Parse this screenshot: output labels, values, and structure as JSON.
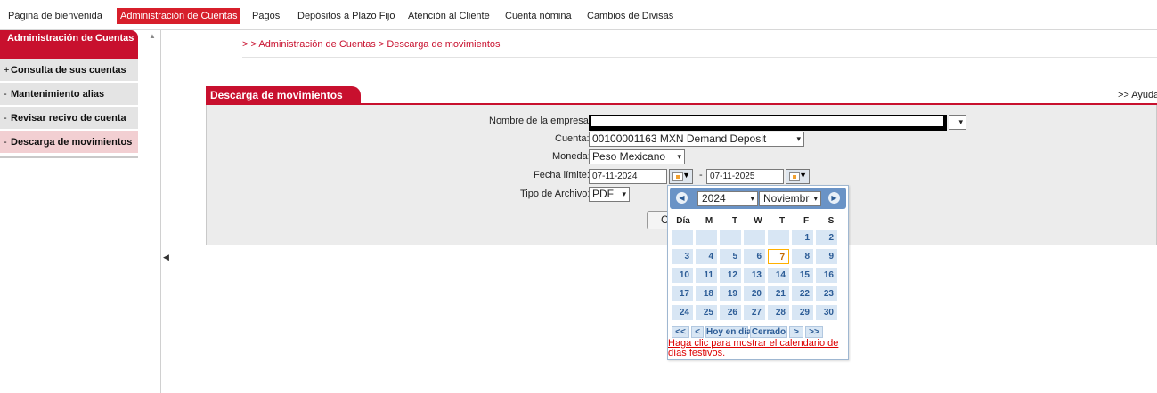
{
  "topnav": [
    {
      "label": "Página de bienvenida",
      "active": false
    },
    {
      "label": "Administración de Cuentas",
      "active": true
    },
    {
      "label": "Pagos",
      "active": false
    },
    {
      "label": "Depósitos a Plazo Fijo",
      "active": false
    },
    {
      "label": "Atención al Cliente",
      "active": false
    },
    {
      "label": "Cuenta nómina",
      "active": false
    },
    {
      "label": "Cambios de Divisas",
      "active": false
    }
  ],
  "sidebar": {
    "header": "Administración de Cuentas",
    "items": [
      {
        "bullet": "+",
        "label": "Consulta de sus cuentas",
        "selected": false
      },
      {
        "bullet": "-",
        "label": "Mantenimiento alias",
        "selected": false
      },
      {
        "bullet": "-",
        "label": "Revisar recivo de cuenta",
        "selected": false
      },
      {
        "bullet": "-",
        "label": "Descarga de movimientos",
        "selected": true
      }
    ]
  },
  "breadcrumb": "> > Administración de Cuentas > Descarga de movimientos",
  "panel": {
    "title": "Descarga de movimientos",
    "help": ">> Ayuda"
  },
  "form": {
    "empresa_label": "Nombre de la empresa:",
    "cuenta_label": "Cuenta:",
    "cuenta_value": "00100001163 MXN Demand Deposit",
    "moneda_label": "Moneda:",
    "moneda_value": "Peso Mexicano",
    "fecha_label": "Fecha límite:",
    "fecha_desde": "07-11-2024",
    "fecha_sep": "-",
    "fecha_hasta": "07-11-2025",
    "tipo_label": "Tipo de Archivo:",
    "tipo_value": "PDF",
    "button_partial": "C"
  },
  "calendar": {
    "year": "2024",
    "month": "Noviembr",
    "weekdays": [
      "Día",
      "M",
      "T",
      "W",
      "T",
      "F",
      "S"
    ],
    "weeks": [
      [
        "",
        "",
        "",
        "",
        "",
        "1",
        "2"
      ],
      [
        "3",
        "4",
        "5",
        "6",
        "7",
        "8",
        "9"
      ],
      [
        "10",
        "11",
        "12",
        "13",
        "14",
        "15",
        "16"
      ],
      [
        "17",
        "18",
        "19",
        "20",
        "21",
        "22",
        "23"
      ],
      [
        "24",
        "25",
        "26",
        "27",
        "28",
        "29",
        "30"
      ]
    ],
    "today": "7",
    "footer": {
      "prev_year": "<<",
      "prev_month": "<",
      "today_label": "Hoy en día",
      "close_label": "Cerrado",
      "next_month": ">",
      "next_year": ">>"
    },
    "holiday_link": "Haga clic para mostrar el calendario de días festivos."
  },
  "colors": {
    "brand_red": "#c8102e",
    "calendar_blue": "#6a93c6",
    "cell_blue": "#d8e6f4"
  }
}
